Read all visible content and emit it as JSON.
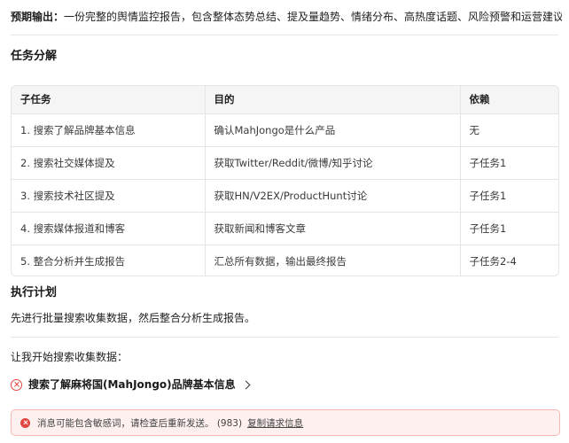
{
  "expected_output": {
    "label": "预期输出",
    "colon": "：",
    "text": "一份完整的舆情监控报告，包含整体态势总结、提及量趋势、情绪分布、高热度话题、风险预警和运营建议。"
  },
  "task_breakdown": {
    "heading": "任务分解",
    "columns": [
      "子任务",
      "目的",
      "依赖"
    ],
    "rows": [
      [
        "1. 搜索了解品牌基本信息",
        "确认MahJongo是什么产品",
        "无"
      ],
      [
        "2. 搜索社交媒体提及",
        "获取Twitter/Reddit/微博/知乎讨论",
        "子任务1"
      ],
      [
        "3. 搜索技术社区提及",
        "获取HN/V2EX/ProductHunt讨论",
        "子任务1"
      ],
      [
        "4. 搜索媒体报道和博客",
        "获取新闻和博客文章",
        "子任务1"
      ],
      [
        "5. 整合分析并生成报告",
        "汇总所有数据，输出最终报告",
        "子任务2-4"
      ]
    ]
  },
  "execution_plan": {
    "heading": "执行计划",
    "text": "先进行批量搜索收集数据，然后整合分析生成报告。"
  },
  "start_text": "让我开始搜索收集数据：",
  "task_step": {
    "label": "搜索了解麻将国(MahJongo)品牌基本信息",
    "status_icon": "error-circle-icon"
  },
  "error_banner": {
    "message": "消息可能包含敏感词，请检查后重新发送。 (983)",
    "link": "复制请求信息",
    "accent": "#e0453e"
  }
}
